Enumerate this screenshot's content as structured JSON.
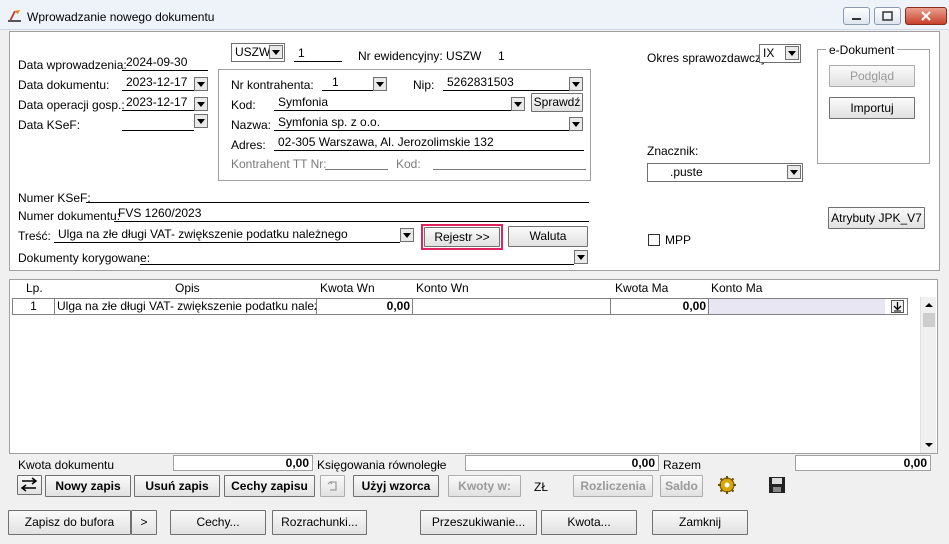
{
  "window": {
    "title": "Wprowadzanie nowego dokumentu"
  },
  "header": {
    "data_wprowadzenia_label": "Data wprowadzenia:",
    "data_wprowadzenia": "2024-09-30",
    "data_dokumentu_label": "Data dokumentu:",
    "data_dokumentu": "2023-12-17",
    "data_operacji_label": "Data operacji gosp.:",
    "data_operacji": "2023-12-17",
    "data_ksef_label": "Data KSeF:",
    "data_ksef": "",
    "rejestr_code": "USZW",
    "rejestr_num": "1",
    "nr_ewidencyjny_label": "Nr ewidencyjny: USZW",
    "nr_ewidencyjny_num": "1",
    "okres_label": "Okres sprawozdawczy:",
    "okres": "IX",
    "numer_ksef_label": "Numer KSeF:",
    "numer_ksef": "",
    "numer_dokumentu_label": "Numer dokumentu:",
    "numer_dokumentu": "FVS 1260/2023",
    "tresc_label": "Treść:",
    "tresc": "Ulga na złe długi VAT- zwiększenie podatku należnego",
    "dokumenty_korygowane_label": "Dokumenty korygowane:",
    "dokumenty_korygowane": "",
    "rejestr_button": "Rejestr >>",
    "waluta_button": "Waluta",
    "znacznik_label": "Znacznik:",
    "znacznik": ".puste",
    "mpp_label": "MPP",
    "atrybuty_button": "Atrybuty JPK_V7"
  },
  "kontrahent": {
    "nr_label": "Nr kontrahenta:",
    "nr": "1",
    "nip_label": "Nip:",
    "nip": "5262831503",
    "kod_label": "Kod:",
    "kod": "Symfonia",
    "sprawdz_button": "Sprawdź",
    "nazwa_label": "Nazwa:",
    "nazwa": "Symfonia sp. z o.o.",
    "adres_label": "Adres:",
    "adres": "02-305 Warszawa, Al. Jerozolimskie 132",
    "tt_nr_label": "Kontrahent TT Nr:",
    "tt_kod_label": "Kod:"
  },
  "edokument": {
    "title": "e-Dokument",
    "podglad_button": "Podgląd",
    "importuj_button": "Importuj"
  },
  "grid": {
    "columns": [
      "Lp.",
      "Opis",
      "Kwota Wn",
      "Konto Wn",
      "Kwota Ma",
      "Konto Ma"
    ],
    "rows": [
      {
        "lp": "1",
        "opis": "Ulga na złe długi VAT- zwiększenie podatku należnego",
        "kwota_wn": "0,00",
        "konto_wn": "",
        "kwota_ma": "0,00",
        "konto_ma": ""
      }
    ]
  },
  "summary": {
    "kwota_dokumentu_label": "Kwota dokumentu",
    "kwota_dokumentu": "0,00",
    "ksiegowania_label": "Księgowania równoległe",
    "ksiegowania": "0,00",
    "razem_label": "Razem",
    "razem": "0,00",
    "currency": "ZŁ"
  },
  "toolbar": {
    "nowy_zapis": "Nowy zapis",
    "usun_zapis": "Usuń zapis",
    "cechy_zapisu": "Cechy zapisu",
    "uzyj_wzorca": "Użyj wzorca",
    "kwoty_w": "Kwoty w:",
    "rozliczenia": "Rozliczenia",
    "saldo": "Saldo"
  },
  "footer": {
    "zapisz_do_bufora": "Zapisz do bufora",
    "more": ">",
    "cechy": "Cechy...",
    "rozrachunki": "Rozrachunki...",
    "przeszukiwanie": "Przeszukiwanie...",
    "kwota": "Kwota...",
    "zamknij": "Zamknij"
  }
}
